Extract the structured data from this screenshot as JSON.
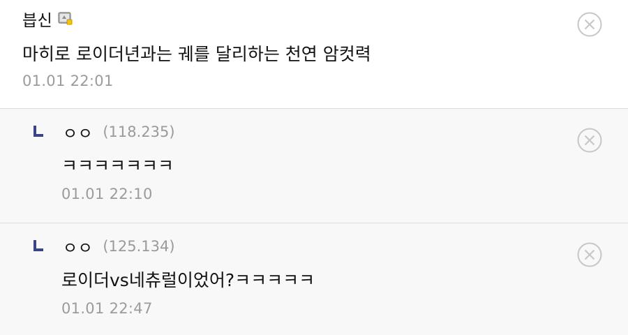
{
  "comments": [
    {
      "nickname": "븝신",
      "has_user_icon": true,
      "body": "마히로 로이더년과는 궤를 달리하는 천연 암컷력",
      "timestamp": "01.01 22:01"
    }
  ],
  "replies": [
    {
      "nickname": "ㅇㅇ",
      "ip": "(118.235)",
      "body": "ㅋㅋㅋㅋㅋㅋㅋ",
      "timestamp": "01.01 22:10"
    },
    {
      "nickname": "ㅇㅇ",
      "ip": "(125.134)",
      "body": "로이더vs네츄럴이었어?ㅋㅋㅋㅋㅋ",
      "timestamp": "01.01 22:47"
    }
  ],
  "icons": {
    "delete": "close-circle-icon",
    "reply": "reply-arrow-icon",
    "user_badge": "fixed-nick-badge-icon"
  },
  "colors": {
    "reply_background": "#f8f8f9",
    "reply_arrow": "#3b4486",
    "muted_text": "#9b9b9b",
    "divider": "#d9dbe2"
  }
}
